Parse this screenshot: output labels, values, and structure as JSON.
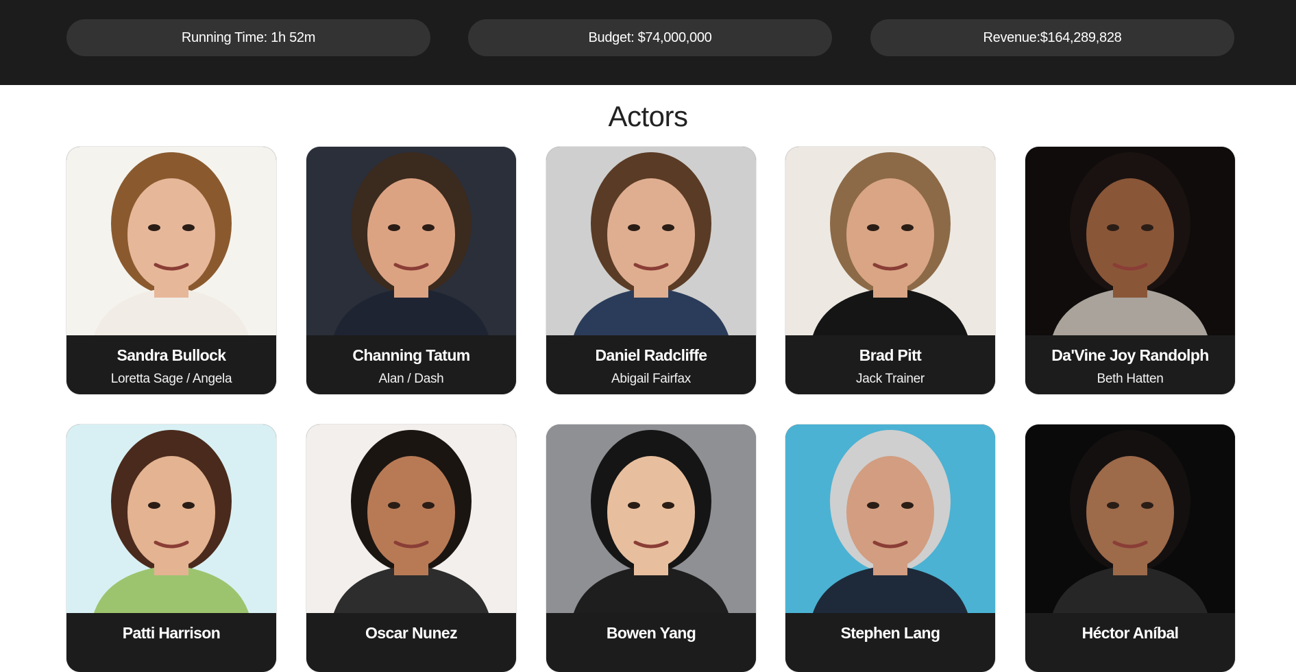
{
  "stats": {
    "running_time": "Running Time: 1h 52m",
    "budget": "Budget: $74,000,000",
    "revenue": "Revenue:$164,289,828"
  },
  "section": {
    "title": "Actors"
  },
  "actors": [
    {
      "name": "Sandra Bullock",
      "role": "Loretta Sage / Angela",
      "bg": "#f5f3ee",
      "skin": "#e7b79a",
      "hair": "#8a5a2e",
      "shirt": "#f1ede6"
    },
    {
      "name": "Channing Tatum",
      "role": "Alan / Dash",
      "bg": "#2a2f3a",
      "skin": "#dca383",
      "hair": "#3b2a1e",
      "shirt": "#1f2433"
    },
    {
      "name": "Daniel Radcliffe",
      "role": "Abigail Fairfax",
      "bg": "#cfcfcf",
      "skin": "#dfae90",
      "hair": "#5a3b25",
      "shirt": "#2b3c5a"
    },
    {
      "name": "Brad Pitt",
      "role": "Jack Trainer",
      "bg": "#ede9e2",
      "skin": "#d9a585",
      "hair": "#8c6a48",
      "shirt": "#151515"
    },
    {
      "name": "Da'Vine Joy Randolph",
      "role": "Beth Hatten",
      "bg": "#0f0c0b",
      "skin": "#8a5638",
      "hair": "#1a1210",
      "shirt": "#a9a39b"
    },
    {
      "name": "Patti Harrison",
      "role": "",
      "bg": "#d8f0f4",
      "skin": "#e4b391",
      "hair": "#4a2a1c",
      "shirt": "#9cc46f"
    },
    {
      "name": "Oscar Nunez",
      "role": "",
      "bg": "#f3efec",
      "skin": "#b87a55",
      "hair": "#1b1512",
      "shirt": "#2d2d2d"
    },
    {
      "name": "Bowen Yang",
      "role": "",
      "bg": "#8f9094",
      "skin": "#e8bf9e",
      "hair": "#151515",
      "shirt": "#1e1e1e"
    },
    {
      "name": "Stephen Lang",
      "role": "",
      "bg": "#4bb2d3",
      "skin": "#d29d80",
      "hair": "#cfcfcf",
      "shirt": "#1e2a3a"
    },
    {
      "name": "Héctor Aníbal",
      "role": "",
      "bg": "#0a0a0a",
      "skin": "#9d6a4a",
      "hair": "#151010",
      "shirt": "#262626"
    }
  ]
}
